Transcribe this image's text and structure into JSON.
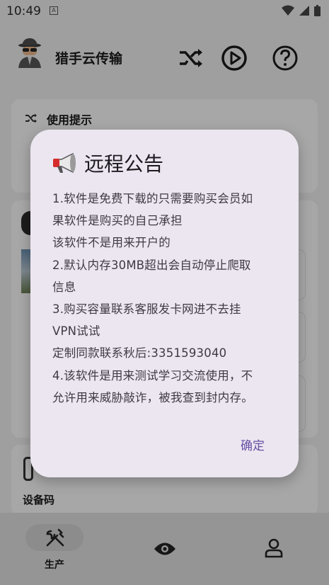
{
  "status_bar": {
    "time": "10:49",
    "notification_letter": "A"
  },
  "app": {
    "title": "猎手云传输"
  },
  "tips_card": {
    "title": "使用提示"
  },
  "device_card": {
    "label": "设备码"
  },
  "bottom_nav": {
    "active_label": "生产"
  },
  "dialog": {
    "title": "远程公告",
    "lines": [
      "1.软件是免费下载的只需要购买会员如",
      "果软件是购买的自己承担",
      "该软件不是用来开户的",
      "2.默认内存30MB超出会自动停止爬取",
      "信息",
      "3.购买容量联系客服发卡网进不去挂",
      "VPN试试",
      "定制同款联系秋后:3351593040",
      "4.该软件是用来测试学习交流使用，不",
      "允许用来威胁敲诈，被我查到封内存。"
    ],
    "confirm_label": "确定"
  },
  "colors": {
    "accent": "#6750a4",
    "dialog_bg": "#ece6f0"
  }
}
